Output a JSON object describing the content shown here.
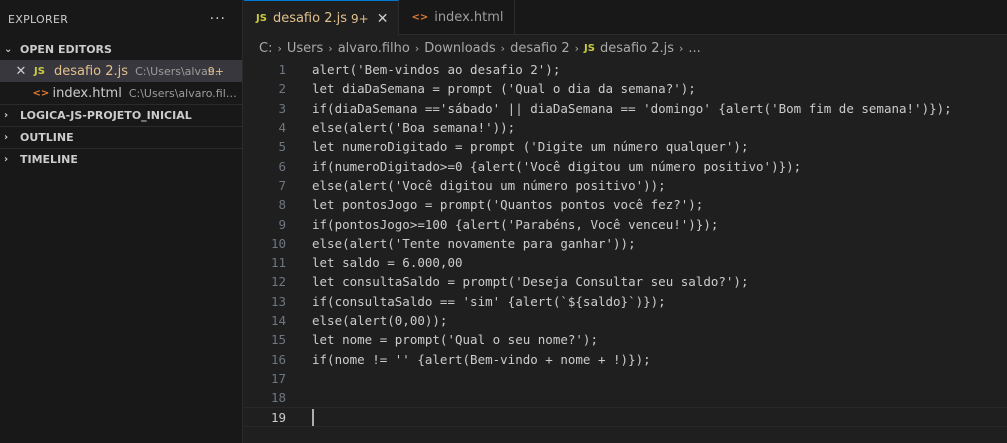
{
  "sidebar": {
    "title": "EXPLORER",
    "more": "···",
    "open_editors_label": "OPEN EDITORS",
    "open_editors": [
      {
        "icon": "JS",
        "name": "desafio 2.js",
        "path": "C:\\Users\\alvar...",
        "badge": "9+"
      },
      {
        "icon": "<>",
        "name": "index.html",
        "path": "C:\\Users\\alvaro.filho\\..."
      }
    ],
    "sections": [
      "LOGICA-JS-PROJETO_INICIAL",
      "OUTLINE",
      "TIMELINE"
    ]
  },
  "tabs": [
    {
      "icon": "JS",
      "label": "desafio 2.js",
      "count": "9+",
      "close": "✕"
    },
    {
      "icon": "<>",
      "label": "index.html"
    }
  ],
  "breadcrumb": [
    "C:",
    "Users",
    "alvaro.filho",
    "Downloads",
    "desafio 2",
    "desafio 2.js",
    "..."
  ],
  "breadcrumb_icon": "JS",
  "colors": {
    "accent": "#0078d4",
    "js_icon": "#cbcb41",
    "html_icon": "#e37933",
    "modified": "#e2c08d"
  },
  "editor": {
    "current_line": 19,
    "lines": [
      "alert('Bem-vindos ao desafio 2');",
      "let diaDaSemana = prompt ('Qual o dia da semana?');",
      "if(diaDaSemana =='sábado' || diaDaSemana == 'domingo' {alert('Bom fim de semana!')});",
      "else(alert('Boa semana!'));",
      "let numeroDigitado = prompt ('Digite um número qualquer');",
      "if(numeroDigitado>=0 {alert('Você digitou um número positivo')});",
      "else(alert('Você digitou um número positivo'));",
      "let pontosJogo = prompt('Quantos pontos você fez?');",
      "if(pontosJogo>=100 {alert('Parabéns, Você venceu!')});",
      "else(alert('Tente novamente para ganhar'));",
      "let saldo = 6.000,00",
      "let consultaSaldo = prompt('Deseja Consultar seu saldo?');",
      "if(consultaSaldo == 'sim' {alert(`${saldo}`)});",
      "else(alert(0,00));",
      "let nome = prompt('Qual o seu nome?');",
      "if(nome != '' {alert(Bem-vindo + nome + !)});",
      "",
      "",
      ""
    ]
  }
}
